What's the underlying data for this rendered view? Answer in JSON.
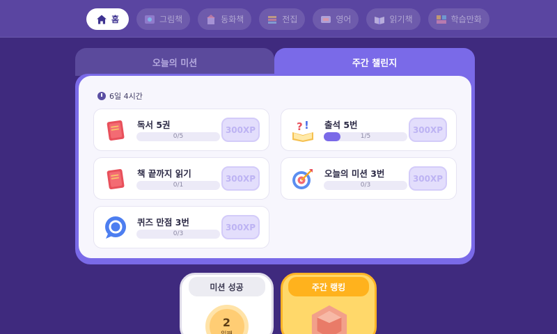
{
  "nav": {
    "items": [
      {
        "label": "홈",
        "icon": "home-icon",
        "active": true
      },
      {
        "label": "그림책",
        "icon": "picture-book-icon",
        "active": false
      },
      {
        "label": "동화책",
        "icon": "storybook-icon",
        "active": false
      },
      {
        "label": "전집",
        "icon": "book-collection-icon",
        "active": false
      },
      {
        "label": "영어",
        "icon": "english-icon",
        "active": false
      },
      {
        "label": "읽기책",
        "icon": "reading-book-icon",
        "active": false
      },
      {
        "label": "학습만화",
        "icon": "learning-comic-icon",
        "active": false
      }
    ]
  },
  "tabs": {
    "today": "오늘의 미션",
    "weekly": "주간 챌린지",
    "active": "weekly"
  },
  "timer": "6일 4시간",
  "missions": [
    {
      "title": "독서 5권",
      "count": "0/5",
      "progress": 0,
      "reward": "300XP",
      "icon": "red-book-icon"
    },
    {
      "title": "출석 5번",
      "count": "1/5",
      "progress": 0.2,
      "reward": "300XP",
      "icon": "attendance-book-icon"
    },
    {
      "title": "책 끝까지 읽기",
      "count": "0/1",
      "progress": 0,
      "reward": "300XP",
      "icon": "red-book-icon"
    },
    {
      "title": "오늘의 미션 3번",
      "count": "0/3",
      "progress": 0,
      "reward": "300XP",
      "icon": "target-icon"
    },
    {
      "title": "퀴즈 만점 3번",
      "count": "0/3",
      "progress": 0,
      "reward": "300XP",
      "icon": "quiz-bubble-icon"
    }
  ],
  "bottom": {
    "success_label": "미션 성공",
    "success_count": "2",
    "success_unit": "일째",
    "ranking_label": "주간 랭킹"
  },
  "colors": {
    "background": "#3f2a7e",
    "accent": "#7a6ae8",
    "xp_text": "#bdb3f3",
    "ranking": "#ffb426"
  }
}
